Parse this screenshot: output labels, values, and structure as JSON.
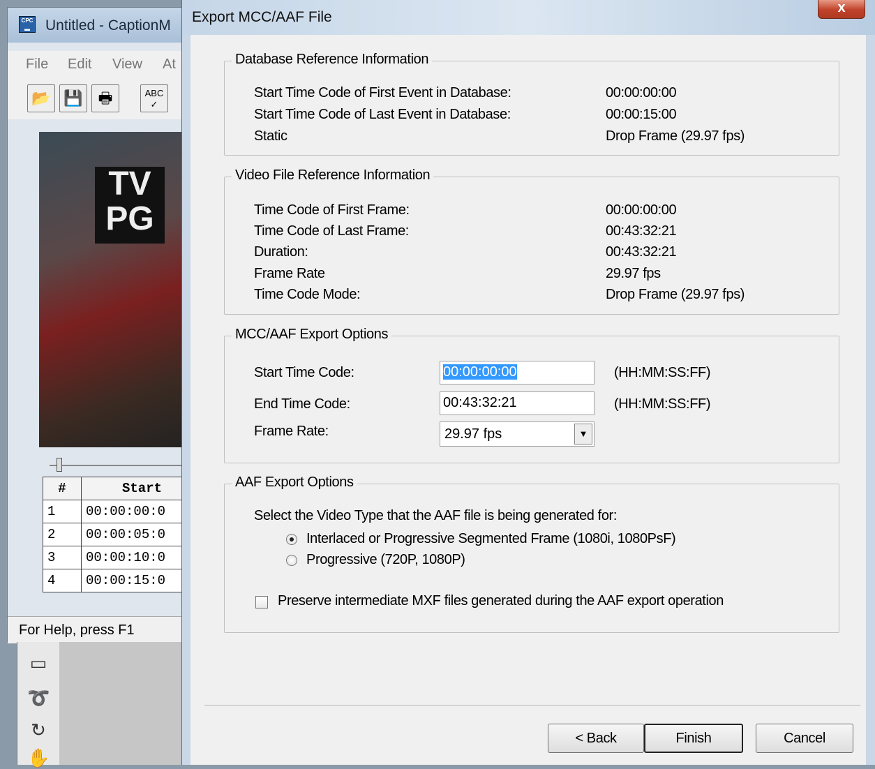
{
  "background_app": {
    "title": "Untitled - CaptionM",
    "menu": [
      "File",
      "Edit",
      "View",
      "At"
    ],
    "video_badge": [
      "TV",
      "PG"
    ],
    "table": {
      "headers": [
        "#",
        "Start"
      ],
      "rows": [
        [
          "1",
          "00:00:00:0"
        ],
        [
          "2",
          "00:00:05:0"
        ],
        [
          "3",
          "00:00:10:0"
        ],
        [
          "4",
          "00:00:15:0"
        ]
      ]
    },
    "status": "For Help, press F1"
  },
  "dialog": {
    "title": "Export MCC/AAF File",
    "close_glyph": "x",
    "database_reference": {
      "title": "Database Reference Information",
      "rows": [
        {
          "label": "Start Time Code of First Event in Database:",
          "value": "00:00:00:00"
        },
        {
          "label": "Start Time Code of Last Event in Database:",
          "value": "00:00:15:00"
        },
        {
          "label": "Static",
          "value": "Drop Frame (29.97 fps)"
        }
      ]
    },
    "video_reference": {
      "title": "Video File Reference Information",
      "rows": [
        {
          "label": "Time Code of First Frame:",
          "value": "00:00:00:00"
        },
        {
          "label": "Time Code of Last Frame:",
          "value": "00:43:32:21"
        },
        {
          "label": "Duration:",
          "value": "00:43:32:21"
        },
        {
          "label": "Frame Rate",
          "value": "29.97 fps"
        },
        {
          "label": "Time Code Mode:",
          "value": "Drop Frame (29.97 fps)"
        }
      ]
    },
    "export_options": {
      "title": "MCC/AAF Export Options",
      "start_label": "Start Time Code:",
      "start_value": "00:00:00:00",
      "start_hint": "(HH:MM:SS:FF)",
      "end_label": "End Time Code:",
      "end_value": "00:43:32:21",
      "end_hint": "(HH:MM:SS:FF)",
      "frame_rate_label": "Frame Rate:",
      "frame_rate_value": "29.97 fps"
    },
    "aaf_options": {
      "title": "AAF Export Options",
      "prompt": "Select the Video Type that the AAF file is being generated for:",
      "radio_interlaced": "Interlaced or Progressive Segmented Frame (1080i, 1080PsF)",
      "radio_progressive": "Progressive (720P, 1080P)",
      "selected": "interlaced",
      "preserve_label": "Preserve intermediate MXF files generated during the AAF export operation",
      "preserve_checked": false
    },
    "buttons": {
      "back": "< Back",
      "finish": "Finish",
      "cancel": "Cancel"
    }
  }
}
